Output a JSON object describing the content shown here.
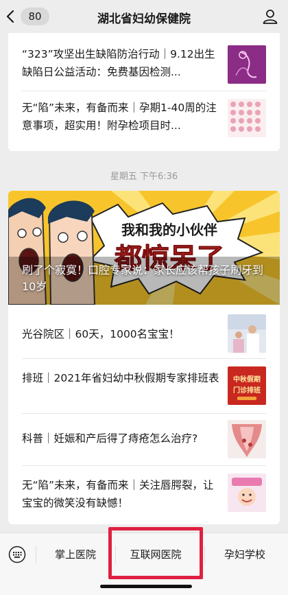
{
  "header": {
    "unread_count": "80",
    "title": "湖北省妇幼保健院"
  },
  "top_articles": [
    {
      "title": "“323”攻坚出生缺陷防治行动｜9.12出生缺陷日公益活动：免费基因检测..."
    },
    {
      "title": "无“陷”未来，有备而来｜孕期1-40周的注意事项，超实用！附孕检项目时..."
    }
  ],
  "timestamp": "星期五 下午6:36",
  "hero": {
    "banner_text_small": "我和我的小伙伴",
    "banner_text_big": "都惊呆了",
    "caption": "刷了个寂寞！口腔专家说：家长应该帮孩子刷牙到10岁"
  },
  "articles": [
    {
      "title": "光谷院区｜60天，1000名宝宝！"
    },
    {
      "title": "排班｜2021年省妇幼中秋假期专家排班表",
      "thumb_text": "中秋假期门诊排班"
    },
    {
      "title": "科普｜妊娠和产后得了痔疮怎么治疗?"
    },
    {
      "title": "无“陷”未来，有备而来｜关注唇腭裂，让宝宝的微笑没有缺憾！"
    }
  ],
  "menu": [
    {
      "label": "掌上医院"
    },
    {
      "label": "互联网医院"
    },
    {
      "label": "孕妇学校"
    }
  ],
  "colors": {
    "highlight": "#e02040",
    "banner_yellow": "#f7c52b"
  }
}
